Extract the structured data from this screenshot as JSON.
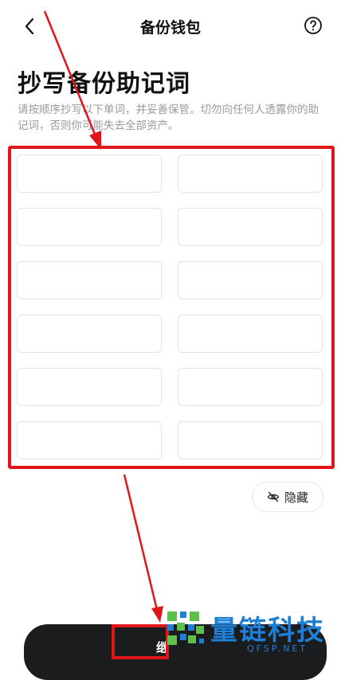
{
  "header": {
    "title": "备份钱包"
  },
  "page": {
    "heading": "抄写备份助记词",
    "description": "请按顺序抄写以下单词，并妥善保管。切勿向任何人透露你的助记词，否则你可能失去全部资产。"
  },
  "mnemonic_words": [
    "",
    "",
    "",
    "",
    "",
    "",
    "",
    "",
    "",
    "",
    "",
    ""
  ],
  "hide_button": {
    "label": "隐藏"
  },
  "next_button": {
    "label": "继"
  },
  "watermark": {
    "brand": "量链科技",
    "domain": "QFSP.NET"
  },
  "colors": {
    "annotation_red": "#e0161b",
    "button_dark": "#1b1c1e",
    "watermark_blue": "#1e7fd6",
    "watermark_green": "#5cc04a",
    "muted_text": "#9a9a9a"
  },
  "icons": {
    "back": "chevron-left-icon",
    "help": "question-circle-icon",
    "hide": "eye-off-icon"
  }
}
